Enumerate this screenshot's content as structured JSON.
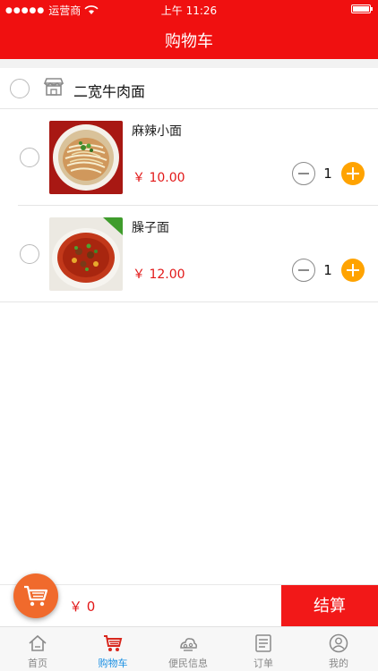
{
  "status_bar": {
    "carrier": "运营商",
    "time": "上午 11:26"
  },
  "header": {
    "title": "购物车"
  },
  "store": {
    "name": "二宽牛肉面"
  },
  "items": [
    {
      "name": "麻辣小面",
      "price": "￥ 10.00",
      "qty": "1"
    },
    {
      "name": "臊子面",
      "price": "￥ 12.00",
      "qty": "1"
    }
  ],
  "checkout": {
    "total": "￥ 0",
    "pay_label": "结算"
  },
  "tabbar": [
    {
      "label": "首页",
      "icon": "home-icon"
    },
    {
      "label": "购物车",
      "icon": "cart-icon",
      "active": true
    },
    {
      "label": "便民信息",
      "icon": "service-icon"
    },
    {
      "label": "订单",
      "icon": "order-icon"
    },
    {
      "label": "我的",
      "icon": "profile-icon"
    }
  ],
  "colors": {
    "primary": "#f01010",
    "accent": "#ffa300",
    "price": "#e21818",
    "tab_active": "#1a8fe3"
  }
}
